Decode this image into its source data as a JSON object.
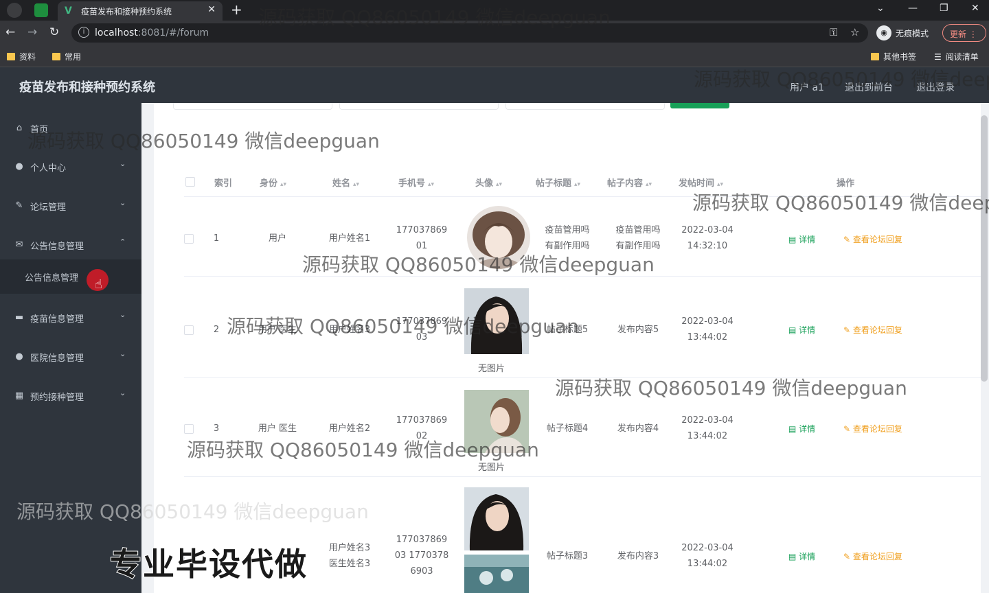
{
  "browser": {
    "tab_title": "疫苗发布和接种预约系统",
    "tab_close": "✕",
    "new_tab": "+",
    "url_host": "localhost",
    "url_rest": ":8081/#/forum",
    "incognito_label": "无痕模式",
    "update_label": "更新",
    "bookmarks": [
      "资料",
      "常用"
    ],
    "bookmarks_right": [
      "其他书签",
      "阅读清单"
    ]
  },
  "header": {
    "title": "疫苗发布和接种预约系统",
    "user": "用户 a1",
    "back_to_front": "退出到前台",
    "logout": "退出登录"
  },
  "sidebar": {
    "items": [
      {
        "label": "首页",
        "icon": "home-icon",
        "chevron": false
      },
      {
        "label": "个人中心",
        "icon": "user-icon",
        "chevron": true
      },
      {
        "label": "论坛管理",
        "icon": "edit-icon",
        "chevron": true
      },
      {
        "label": "公告信息管理",
        "icon": "mail-icon",
        "chevron": true,
        "expanded": true
      },
      {
        "label": "疫苗信息管理",
        "icon": "folder-icon",
        "chevron": true
      },
      {
        "label": "医院信息管理",
        "icon": "user-icon",
        "chevron": true
      },
      {
        "label": "预约接种管理",
        "icon": "grid-icon",
        "chevron": true
      }
    ],
    "sub_item": "公告信息管理"
  },
  "table": {
    "headers": {
      "index": "索引",
      "role": "身份",
      "name": "姓名",
      "phone": "手机号",
      "avatar": "头像",
      "post_title": "帖子标题",
      "post_content": "帖子内容",
      "post_time": "发帖时间",
      "ops": "操作"
    },
    "rows": [
      {
        "index": "1",
        "role": "用户",
        "name": "用户姓名1",
        "phone_1": "177037869",
        "phone_2": "01",
        "title_1": "疫苗管用吗",
        "title_2": "有副作用吗",
        "content_1": "疫苗管用吗",
        "content_2": "有副作用吗",
        "date": "2022-03-04",
        "time": "14:32:10"
      },
      {
        "index": "2",
        "role": "用户 医生",
        "name": "用户姓名3",
        "phone_1": "177037869",
        "phone_2": "03",
        "no_img": "无图片",
        "title": "帖子标题5",
        "content": "发布内容5",
        "date": "2022-03-04",
        "time": "13:44:02"
      },
      {
        "index": "3",
        "role": "用户 医生",
        "name": "用户姓名2",
        "phone_1": "177037869",
        "phone_2": "02",
        "no_img": "无图片",
        "title": "帖子标题4",
        "content": "发布内容4",
        "date": "2022-03-04",
        "time": "13:44:02"
      },
      {
        "index": "",
        "role": "",
        "name_1": "用户姓名3",
        "name_2": "医生姓名3",
        "phone_1": "177037869",
        "phone_2": "03 1770378",
        "phone_3": "6903",
        "title": "帖子标题3",
        "content": "发布内容3",
        "date": "2022-03-04",
        "time": "13:44:02"
      }
    ],
    "actions": {
      "detail": "详情",
      "reply": "查看论坛回复"
    }
  },
  "watermark": "源码获取 QQ86050149 微信deepguan",
  "promo": "专业毕设代做",
  "colors": {
    "sidebar_bg": "#2f353d",
    "accent_green": "#18a058",
    "accent_orange": "#f0a020"
  }
}
